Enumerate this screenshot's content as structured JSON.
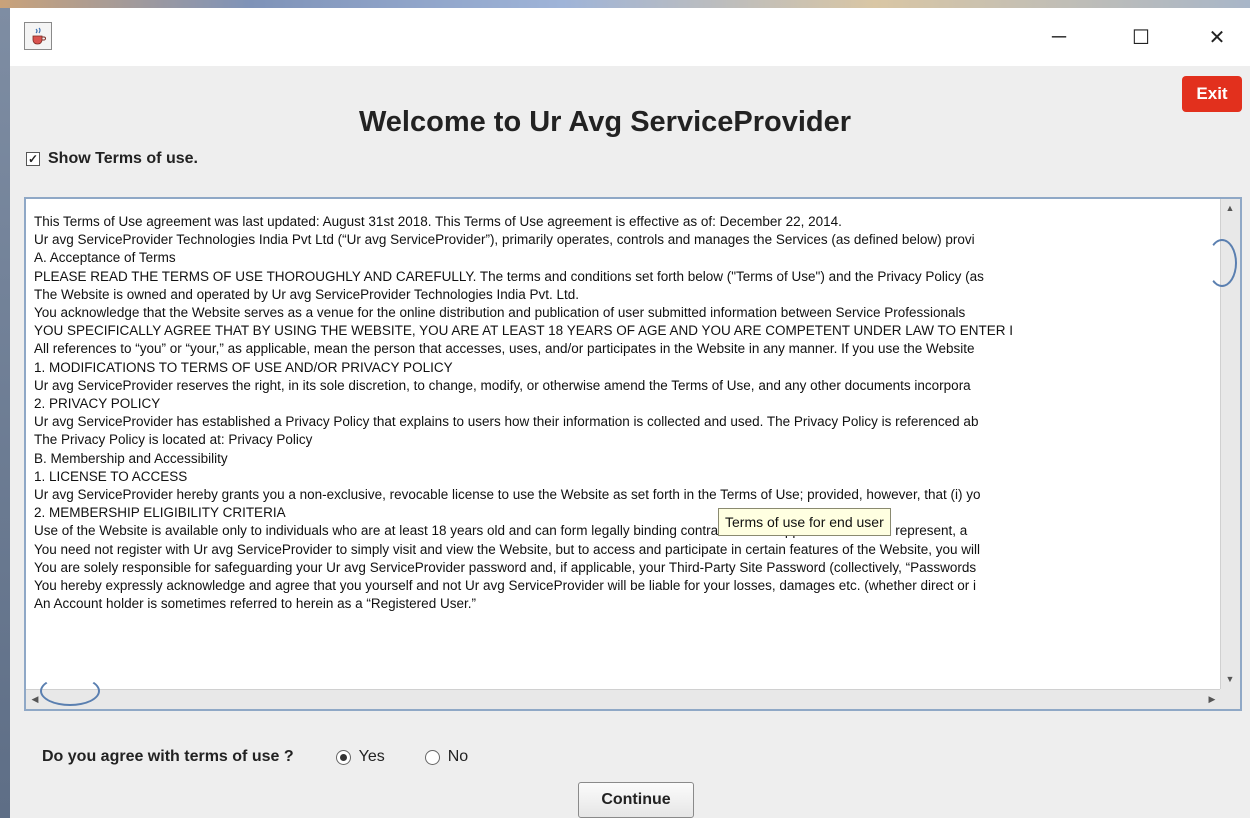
{
  "window": {
    "icon": "java-cup-icon",
    "controls": {
      "minimize": "─",
      "maximize": "☐",
      "close": "✕"
    }
  },
  "header": {
    "title": "Welcome to Ur Avg ServiceProvider",
    "exit_label": "Exit",
    "exit_color": "#e2301d"
  },
  "show_terms": {
    "label": "Show Terms of use.",
    "checked": true
  },
  "terms": {
    "lines": [
      "This Terms of Use agreement was last updated: August 31st 2018. This Terms of Use agreement is effective as of: December 22, 2014.",
      "Ur avg ServiceProvider Technologies India Pvt Ltd (“Ur avg ServiceProvider”), primarily operates, controls and manages the Services (as defined below) provi",
      "A. Acceptance of Terms",
      "PLEASE READ THE TERMS OF USE THOROUGHLY AND CAREFULLY. The terms and conditions set forth below (\"Terms of Use\") and the Privacy Policy (as",
      "The Website is owned and operated by Ur avg ServiceProvider Technologies India Pvt. Ltd.",
      "You acknowledge that the Website serves as a venue for the online distribution and publication of user submitted information between Service Professionals",
      "YOU SPECIFICALLY AGREE THAT BY USING THE WEBSITE, YOU ARE AT LEAST 18 YEARS OF AGE AND YOU ARE COMPETENT UNDER LAW TO ENTER I",
      "All references to “you” or “your,” as applicable, mean the person that accesses, uses, and/or participates in the Website in any manner. If you use the Website",
      "1. MODIFICATIONS TO TERMS OF USE AND/OR PRIVACY POLICY",
      "Ur avg ServiceProvider reserves the right, in its sole discretion, to change, modify, or otherwise amend the Terms of Use, and any other documents incorpora",
      "2. PRIVACY POLICY",
      "Ur avg ServiceProvider has established a Privacy Policy that explains to users how their information is collected and used. The Privacy Policy is referenced ab",
      "The Privacy Policy is located at: Privacy Policy",
      "B. Membership and Accessibility",
      "1. LICENSE TO ACCESS",
      "Ur avg ServiceProvider hereby grants you a non-exclusive, revocable license to use the Website as set forth in the Terms of Use; provided, however, that (i) yo",
      "2. MEMBERSHIP ELIGIBILITY CRITERIA",
      "Use of the Website is available only to individuals who are at least 18 years old and can form legally binding contracts under applicable law. You represent, a",
      "You need not register with Ur avg ServiceProvider to simply visit and view the Website, but to access and participate in certain features of the Website, you will",
      "You are solely responsible for safeguarding your Ur avg ServiceProvider password and, if applicable, your Third-Party Site Password (collectively, “Passwords",
      "You hereby expressly acknowledge and agree that you yourself and not Ur avg ServiceProvider will be liable for your losses, damages etc. (whether direct or i",
      "An Account holder is sometimes referred to herein as a “Registered User.”"
    ],
    "tooltip": "Terms of use for end user"
  },
  "agreement": {
    "question": "Do you agree with terms of use ?",
    "options": [
      {
        "label": "Yes",
        "selected": true
      },
      {
        "label": "No",
        "selected": false
      }
    ]
  },
  "continue_label": "Continue"
}
